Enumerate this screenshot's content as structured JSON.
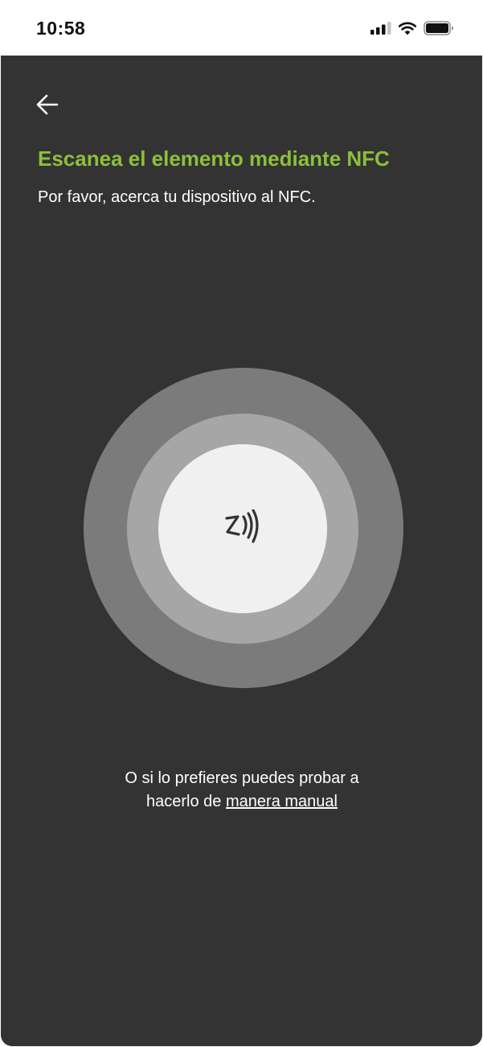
{
  "status_bar": {
    "time": "10:58"
  },
  "icons": {
    "signal": "cellular-signal-icon",
    "wifi": "wifi-icon",
    "battery": "battery-icon",
    "back": "arrow-left-icon",
    "nfc": "nfc-icon"
  },
  "header": {
    "title": "Escanea el elemento mediante NFC",
    "subtitle": "Por favor, acerca tu dispositivo al NFC."
  },
  "footer": {
    "line1": "O si lo prefieres puedes probar a",
    "line2_prefix": "hacerlo de ",
    "manual_link": "manera manual"
  },
  "colors": {
    "background": "#333333",
    "title_accent": "#8dbf3c",
    "ring_outer": "#7b7b7b",
    "ring_middle": "#a6a6a6",
    "ring_inner": "#f0f0f0"
  }
}
